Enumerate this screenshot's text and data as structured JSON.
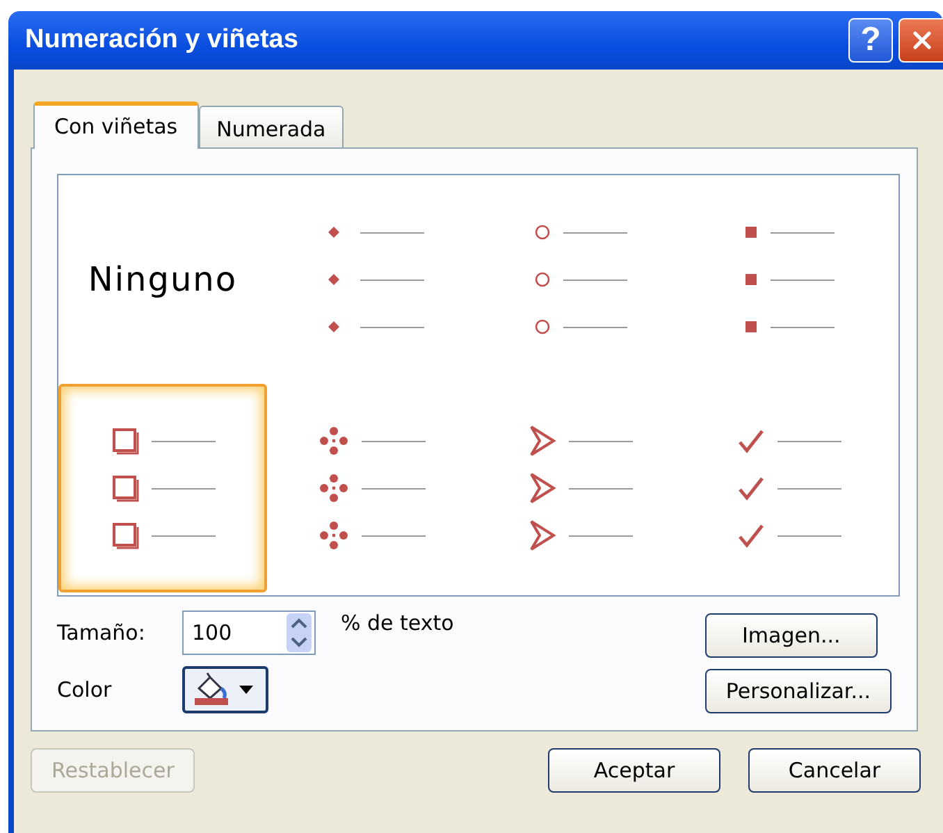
{
  "window": {
    "title": "Numeración y viñetas"
  },
  "title_buttons": [
    {
      "kind": "help",
      "label": "?"
    },
    {
      "kind": "close"
    }
  ],
  "tabs": [
    {
      "label": "Con viñetas",
      "selected": true
    },
    {
      "label": "Numerada",
      "selected": false
    }
  ],
  "bullet_styles": [
    {
      "kind": "none",
      "label": "Ninguno",
      "selected": false
    },
    {
      "kind": "dot",
      "selected": false
    },
    {
      "kind": "circle",
      "selected": false
    },
    {
      "kind": "square",
      "selected": false
    },
    {
      "kind": "hollow-square",
      "selected": true
    },
    {
      "kind": "dots",
      "selected": false
    },
    {
      "kind": "arrowhead",
      "selected": false
    },
    {
      "kind": "check",
      "selected": false
    }
  ],
  "size": {
    "label": "Tamaño:",
    "value": "100",
    "suffix": "% de texto"
  },
  "color": {
    "label": "Color",
    "color": "#c0504d"
  },
  "side_buttons": [
    "Imagen...",
    "Personalizar..."
  ],
  "footer": {
    "reset": {
      "label": "Restablecer",
      "disabled": true
    },
    "buttons": [
      "Aceptar",
      "Cancelar"
    ]
  }
}
